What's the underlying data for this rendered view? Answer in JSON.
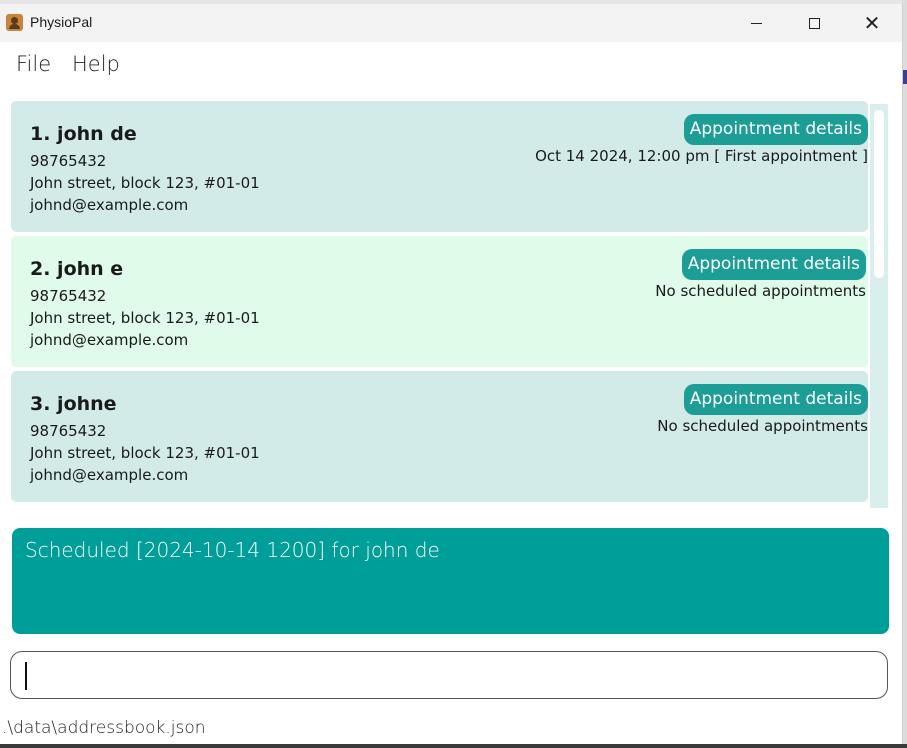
{
  "window": {
    "title": "PhysioPal"
  },
  "menu": {
    "file": "File",
    "help": "Help"
  },
  "patients": [
    {
      "name": "1. john de",
      "phone": "98765432",
      "address": "John street, block 123, #01-01",
      "email": "johnd@example.com",
      "appointment_button": "Appointment details",
      "appointment_info": "Oct 14 2024, 12:00 pm [ First appointment ]"
    },
    {
      "name": "2. john e",
      "phone": "98765432",
      "address": "John street, block 123, #01-01",
      "email": "johnd@example.com",
      "appointment_button": "Appointment details",
      "appointment_info": "No scheduled appointments"
    },
    {
      "name": "3. johne",
      "phone": "98765432",
      "address": "John street, block 123, #01-01",
      "email": "johnd@example.com",
      "appointment_button": "Appointment details",
      "appointment_info": "No scheduled appointments"
    }
  ],
  "result": {
    "message": "Scheduled [2024-10-14 1200] for john de"
  },
  "command": {
    "value": ""
  },
  "status": {
    "file_path": ".\\data\\addressbook.json"
  },
  "colors": {
    "accent": "#009e98",
    "button": "#1c9e97",
    "card_default": "#d3ebe8",
    "card_selected": "#e0fbe9"
  }
}
